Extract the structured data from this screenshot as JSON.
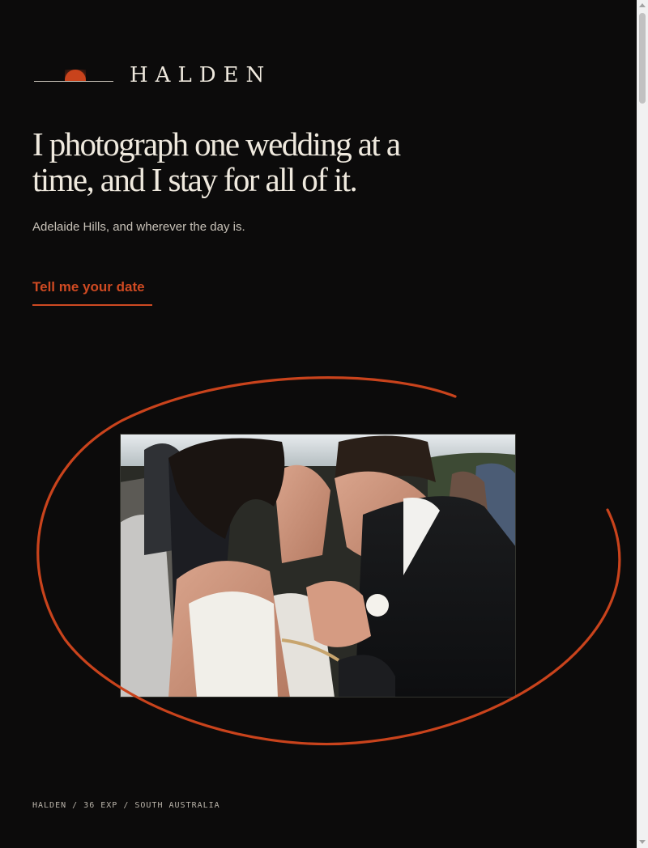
{
  "brand": {
    "name": "HALDEN",
    "logo_icon": "sunset-horizon-icon"
  },
  "hero": {
    "headline": "I photograph one wedding at a time, and I stay for all of it.",
    "subline": "Adelaide Hills, and wherever the day is.",
    "cta_label": "Tell me your date"
  },
  "photo": {
    "description_icon": "wedding-couple-photo"
  },
  "footer": {
    "text": "HALDEN / 36 EXP / SOUTH AUSTRALIA"
  },
  "colors": {
    "accent": "#cf4a22",
    "background": "#0c0b0b",
    "text": "#efe9de"
  }
}
